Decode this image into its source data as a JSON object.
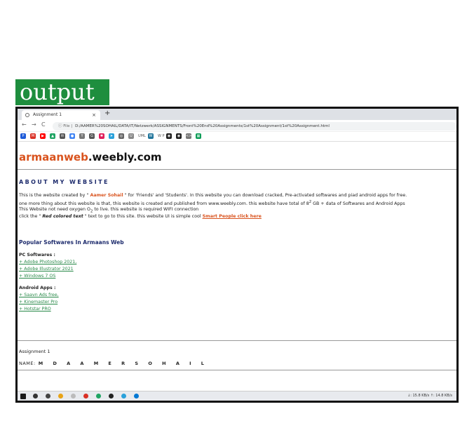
{
  "label": "output",
  "browser": {
    "tab_title": "Assignment 1",
    "tab_close": "×",
    "new_tab": "+",
    "back": "←",
    "forward": "→",
    "reload": "C",
    "url_info": "ⓘ File |",
    "url": "D:/AAMER%20SOHAIL/DATA/IT/Netzwerk/ASSIGNMENTS/Front%20End%20Assignments/1st%20Assignment/1st%20Assignment.html"
  },
  "bookmarks": [
    {
      "icon": "p-icon",
      "color": "#1e5bd8",
      "glyph": "P"
    },
    {
      "icon": "gmail-icon",
      "color": "#d93025",
      "glyph": "M"
    },
    {
      "icon": "youtube-icon",
      "color": "#ff0000",
      "glyph": "▶"
    },
    {
      "icon": "drive-icon",
      "color": "#1fa463",
      "glyph": "▲"
    },
    {
      "icon": "mail-icon",
      "color": "#555555",
      "glyph": "✉"
    },
    {
      "icon": "chrome-icon",
      "color": "#4285f4",
      "glyph": "●"
    },
    {
      "icon": "y-icon",
      "color": "#777777",
      "glyph": "Y"
    },
    {
      "icon": "gc-icon",
      "color": "#555555",
      "glyph": "G"
    },
    {
      "icon": "slack-icon",
      "color": "#e01e5a",
      "glyph": "✱"
    },
    {
      "icon": "telegram-icon",
      "color": "#2aa1da",
      "glyph": "➤"
    },
    {
      "icon": "globe-icon",
      "color": "#666666",
      "glyph": "◎"
    },
    {
      "icon": "uml-icon",
      "color": "#888888",
      "glyph": "U"
    },
    {
      "icon": "wp-icon",
      "color": "#21759b",
      "glyph": "W"
    },
    {
      "icon": "github-icon",
      "color": "#222222",
      "glyph": "◉"
    },
    {
      "icon": "github-alt-icon",
      "color": "#222222",
      "glyph": "◉"
    },
    {
      "icon": "code-icon",
      "color": "#777777",
      "glyph": "<>"
    },
    {
      "icon": "sheets-icon",
      "color": "#0f9d58",
      "glyph": "▦"
    }
  ],
  "bookmark_texts": {
    "uml": "UML",
    "wp": "W P"
  },
  "site": {
    "brand": "armaanweb",
    "domain": ".weebly.com"
  },
  "about": {
    "heading": "ABOUT MY WEBSITE",
    "line1_a": "This is the website created by \"",
    "line1_author": " Aamer Sohail ",
    "line1_b": "\" for 'Friends' and 'Students'. In this website you can download cracked, Pre-activated softwares and piad android apps for free.",
    "line2_a": "one more thing about this website is that, this website is created and published from www.weebly.com. this website have total of 8",
    "line2_sup": "2",
    "line2_b": " GB + data of Softwares and Android Apps",
    "line3_a": "This Website not need oxygen O",
    "line3_sub": "2",
    "line3_b": " to live. this website is required WIFI connection",
    "line4_a": "click the \" ",
    "line4_red": "Red colored text",
    "line4_b": " \" text to go to this site. this website UI is simple cool ",
    "line4_link": "Smart People click here"
  },
  "popular": {
    "heading": "Popular Softwares In Armaans Web",
    "pc_label": "PC Softwares :",
    "pc_items": [
      "+ Adobe Photoshop 2021,",
      "+ Adobe Illustrator 2021",
      "+ Windows 7 OS"
    ],
    "android_label": "Android Apps :",
    "android_items": [
      "+ Saavn Ads free,",
      "+ Kinemaster Pro",
      "+ Hotstar PRO"
    ]
  },
  "footer": {
    "assignment": "Assignment 1",
    "name_label": "NAME:",
    "name_value": "M D  A A M E R  S O H A I L"
  },
  "taskbar": {
    "tray_text": "↓: 15.8 KB/s   ↑: 14.8 KB/s"
  }
}
